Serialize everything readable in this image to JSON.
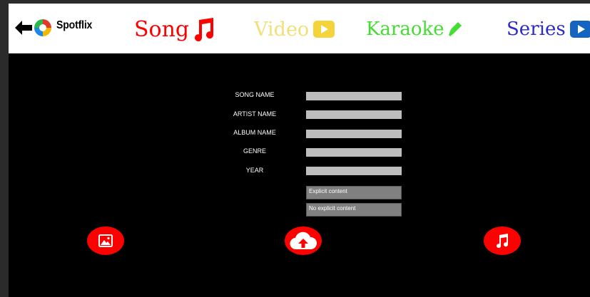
{
  "brand": {
    "name": "Spotflix"
  },
  "nav": {
    "tabs": [
      {
        "label": "Song",
        "color": "#ff0000",
        "icon": "music-note-icon"
      },
      {
        "label": "Video",
        "color": "#f0e07a",
        "icon": "play-icon"
      },
      {
        "label": "Karaoke",
        "color": "#44dd33",
        "icon": "microphone-icon"
      },
      {
        "label": "Series",
        "color": "#2b2bcc",
        "icon": "play-icon"
      }
    ]
  },
  "form": {
    "fields": [
      {
        "label": "SONG NAME",
        "value": ""
      },
      {
        "label": "ARTIST NAME",
        "value": ""
      },
      {
        "label": "ALBUM NAME",
        "value": ""
      },
      {
        "label": "GENRE",
        "value": ""
      },
      {
        "label": "YEAR",
        "value": ""
      }
    ],
    "options": [
      {
        "label": "Explicit content"
      },
      {
        "label": "No explicit content"
      }
    ]
  },
  "actions": [
    {
      "icon": "image-icon"
    },
    {
      "icon": "cloud-upload-icon"
    },
    {
      "icon": "music-note-icon"
    }
  ],
  "colors": {
    "accent": "#ff0000",
    "background": "#000000",
    "header": "#ffffff"
  }
}
